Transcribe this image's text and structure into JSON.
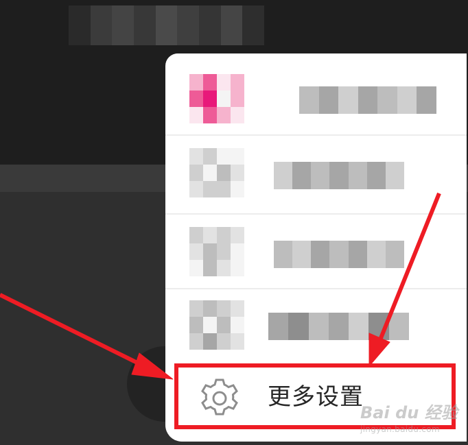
{
  "menu": {
    "items": [
      {
        "name": "menu-item-1",
        "icon": "blurred-pink-app-icon"
      },
      {
        "name": "menu-item-2",
        "icon": "blurred-document-icon"
      },
      {
        "name": "menu-item-3",
        "icon": "blurred-monitor-icon"
      },
      {
        "name": "menu-item-4",
        "icon": "blurred-image-icon"
      }
    ],
    "settings": {
      "label": "更多设置",
      "icon": "gear-icon"
    }
  },
  "annotations": {
    "arrow_color": "#ee1c24",
    "highlight_color": "#ee1c24"
  },
  "watermark": {
    "logo": "Bai du 经验",
    "url": "jingyan.baidu.com"
  },
  "colors": {
    "background": "#1e1e1e",
    "popup": "#ffffff",
    "accent_pink": "#e8197a"
  }
}
